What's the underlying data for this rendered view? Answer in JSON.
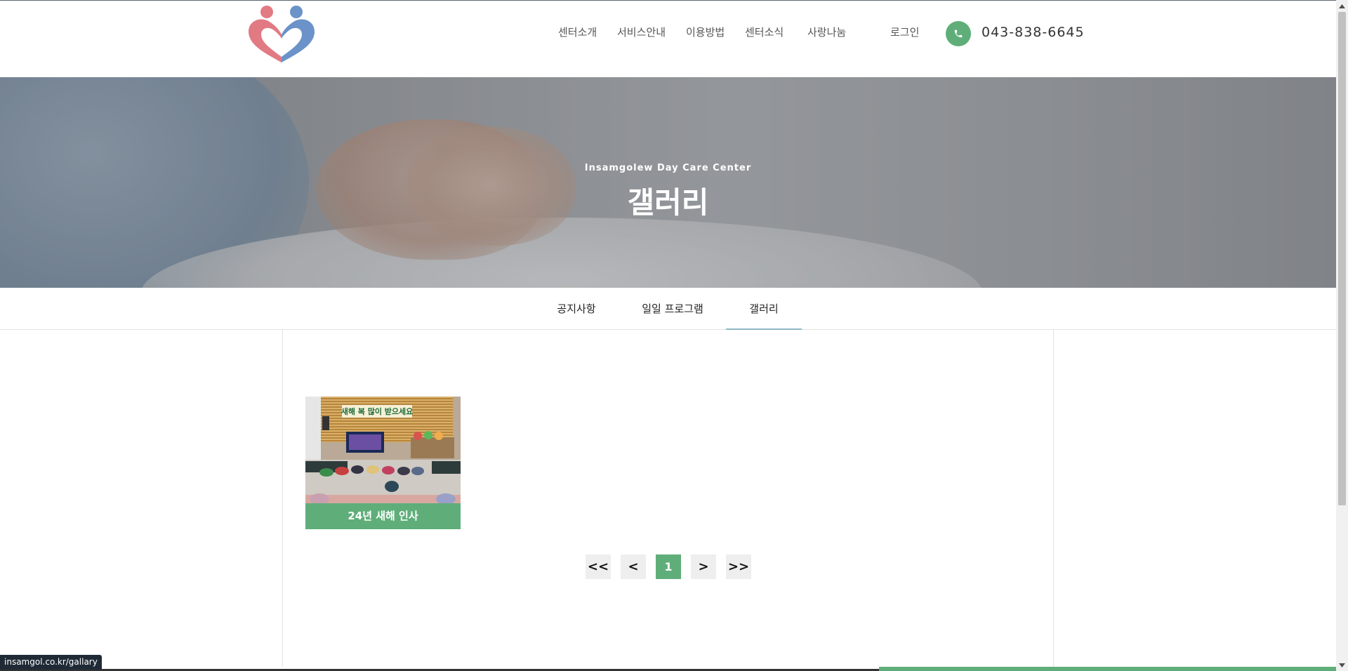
{
  "header": {
    "nav": [
      {
        "label": "센터소개"
      },
      {
        "label": "서비스안내"
      },
      {
        "label": "이용방법"
      },
      {
        "label": "센터소식"
      },
      {
        "label": "사랑나눔"
      }
    ],
    "login_label": "로그인",
    "phone_number": "043-838-6645"
  },
  "hero": {
    "subtitle": "Insamgolew Day Care Center",
    "title": "갤러리"
  },
  "subnav": {
    "tabs": [
      {
        "label": "공지사항",
        "active": false
      },
      {
        "label": "일일 프로그램",
        "active": false
      },
      {
        "label": "갤러리",
        "active": true
      }
    ]
  },
  "gallery": {
    "items": [
      {
        "caption": "24년 새해 인사",
        "banner_text": "새해 복 많이 받으세요"
      }
    ]
  },
  "pagination": {
    "first_label": "<<",
    "prev_label": "<",
    "current_page": "1",
    "next_label": ">",
    "last_label": ">>"
  },
  "status_bar": {
    "url": "insamgol.co.kr/gallary"
  },
  "colors": {
    "accent_green": "#5fae79",
    "logo_red": "#e27a83",
    "logo_blue": "#6b93c9"
  }
}
